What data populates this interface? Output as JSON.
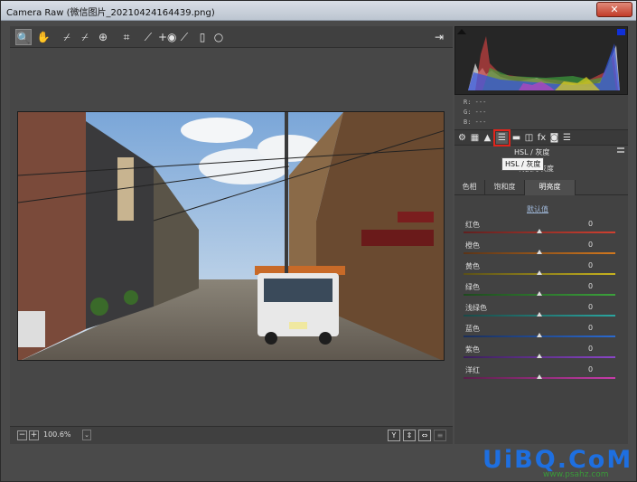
{
  "window": {
    "title": "Camera Raw (微信图片_20210424164439.png)",
    "close_glyph": "✕"
  },
  "toolbar": {
    "tools": [
      {
        "name": "zoom-tool-icon",
        "glyph": "🔍"
      },
      {
        "name": "hand-tool-icon",
        "glyph": "✋"
      },
      {
        "name": "white-balance-tool-icon",
        "glyph": "⌿"
      },
      {
        "name": "color-sampler-tool-icon",
        "glyph": "⌿"
      },
      {
        "name": "targeted-adjustment-tool-icon",
        "glyph": "⊕"
      },
      {
        "name": "crop-tool-icon",
        "glyph": "⌗"
      },
      {
        "name": "straighten-tool-icon",
        "glyph": "⟋"
      },
      {
        "name": "red-eye-tool-icon",
        "glyph": "+◉"
      },
      {
        "name": "adjustment-brush-icon",
        "glyph": "⟋"
      },
      {
        "name": "graduated-filter-icon",
        "glyph": "▯"
      },
      {
        "name": "radial-filter-icon",
        "glyph": "○"
      }
    ],
    "fullscreen_glyph": "⇥"
  },
  "bottom": {
    "zoom_out": "−",
    "zoom_in": "+",
    "zoom_level": "100.6%",
    "zoom_dropdown": "⌄",
    "view_y": "Y",
    "view_swap": "⇕",
    "view_swap2": "⇔",
    "view_menu": "≡"
  },
  "histogram": {
    "r_label": "R:",
    "r_value": "---",
    "g_label": "G:",
    "g_value": "---",
    "b_label": "B:",
    "b_value": "---"
  },
  "panel_icons": [
    {
      "name": "basic-panel-icon",
      "glyph": "⚙"
    },
    {
      "name": "tone-curve-icon",
      "glyph": "▦"
    },
    {
      "name": "detail-icon",
      "glyph": "▲"
    },
    {
      "name": "hsl-panel-icon",
      "glyph": "☰"
    },
    {
      "name": "split-toning-icon",
      "glyph": "▬"
    },
    {
      "name": "lens-corrections-icon",
      "glyph": "◫"
    },
    {
      "name": "effects-icon",
      "glyph": "fx"
    },
    {
      "name": "camera-calibration-icon",
      "glyph": "◙"
    },
    {
      "name": "presets-icon",
      "glyph": "☰"
    }
  ],
  "hsl": {
    "section_title": "HSL / 灰度",
    "tooltip": "HSL / 灰度",
    "convert_label": "转换为灰度",
    "tabs": [
      "色相",
      "饱和度",
      "明亮度"
    ],
    "default_link": "默认值",
    "sliders": [
      {
        "label": "红色",
        "value": "0",
        "color": "#c0392b"
      },
      {
        "label": "橙色",
        "value": "0",
        "color": "#d2781e"
      },
      {
        "label": "黄色",
        "value": "0",
        "color": "#c8b41e"
      },
      {
        "label": "绿色",
        "value": "0",
        "color": "#3ca23c"
      },
      {
        "label": "浅绿色",
        "value": "0",
        "color": "#2aa6a0"
      },
      {
        "label": "蓝色",
        "value": "0",
        "color": "#2a6ad0"
      },
      {
        "label": "紫色",
        "value": "0",
        "color": "#8a46c8"
      },
      {
        "label": "洋红",
        "value": "0",
        "color": "#c83caa"
      }
    ]
  },
  "watermark": {
    "main": "UiBQ.CoM",
    "sub": "www.psahz.com"
  }
}
